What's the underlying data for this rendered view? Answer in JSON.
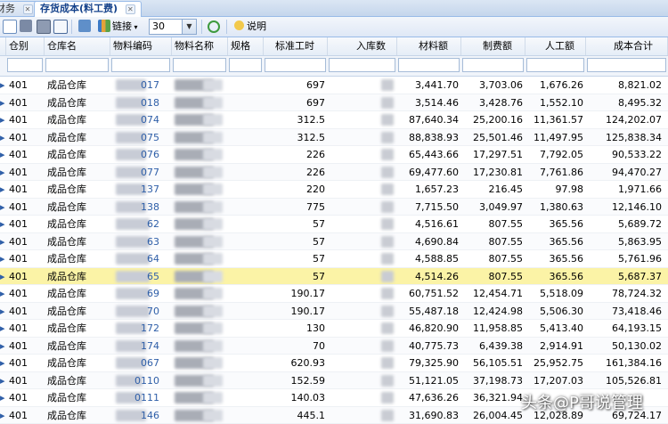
{
  "tabs": [
    {
      "label": "财务",
      "active": false
    },
    {
      "label": "存货成本(料工费)",
      "active": true
    }
  ],
  "toolbar": {
    "link_label": "链接",
    "page_size": "30",
    "help_label": "说明"
  },
  "columns": [
    "仓别",
    "仓库名",
    "物料编码",
    "物料名称",
    "规格",
    "标准工时",
    "入库数",
    "材料额",
    "制费额",
    "人工额",
    "成本合计"
  ],
  "rows": [
    {
      "wh": "401",
      "wh_name": "成品仓库",
      "code_tail": "017",
      "std_hours": "697",
      "material": "3,441.70",
      "overhead": "3,703.06",
      "labor": "1,676.26",
      "total": "8,821.02"
    },
    {
      "wh": "401",
      "wh_name": "成品仓库",
      "code_tail": "018",
      "std_hours": "697",
      "material": "3,514.46",
      "overhead": "3,428.76",
      "labor": "1,552.10",
      "total": "8,495.32"
    },
    {
      "wh": "401",
      "wh_name": "成品仓库",
      "code_tail": "074",
      "std_hours": "312.5",
      "material": "87,640.34",
      "overhead": "25,200.16",
      "labor": "11,361.57",
      "total": "124,202.07"
    },
    {
      "wh": "401",
      "wh_name": "成品仓库",
      "code_tail": "075",
      "std_hours": "312.5",
      "material": "88,838.93",
      "overhead": "25,501.46",
      "labor": "11,497.95",
      "total": "125,838.34"
    },
    {
      "wh": "401",
      "wh_name": "成品仓库",
      "code_tail": "076",
      "std_hours": "226",
      "material": "65,443.66",
      "overhead": "17,297.51",
      "labor": "7,792.05",
      "total": "90,533.22"
    },
    {
      "wh": "401",
      "wh_name": "成品仓库",
      "code_tail": "077",
      "std_hours": "226",
      "material": "69,477.60",
      "overhead": "17,230.81",
      "labor": "7,761.86",
      "total": "94,470.27"
    },
    {
      "wh": "401",
      "wh_name": "成品仓库",
      "code_tail": "137",
      "std_hours": "220",
      "material": "1,657.23",
      "overhead": "216.45",
      "labor": "97.98",
      "total": "1,971.66"
    },
    {
      "wh": "401",
      "wh_name": "成品仓库",
      "code_tail": "138",
      "std_hours": "775",
      "material": "7,715.50",
      "overhead": "3,049.97",
      "labor": "1,380.63",
      "total": "12,146.10"
    },
    {
      "wh": "401",
      "wh_name": "成品仓库",
      "code_tail": "62",
      "std_hours": "57",
      "material": "4,516.61",
      "overhead": "807.55",
      "labor": "365.56",
      "total": "5,689.72"
    },
    {
      "wh": "401",
      "wh_name": "成品仓库",
      "code_tail": "63",
      "std_hours": "57",
      "material": "4,690.84",
      "overhead": "807.55",
      "labor": "365.56",
      "total": "5,863.95"
    },
    {
      "wh": "401",
      "wh_name": "成品仓库",
      "code_tail": "64",
      "std_hours": "57",
      "material": "4,588.85",
      "overhead": "807.55",
      "labor": "365.56",
      "total": "5,761.96"
    },
    {
      "wh": "401",
      "wh_name": "成品仓库",
      "code_tail": "65",
      "std_hours": "57",
      "material": "4,514.26",
      "overhead": "807.55",
      "labor": "365.56",
      "total": "5,687.37",
      "selected": true
    },
    {
      "wh": "401",
      "wh_name": "成品仓库",
      "code_tail": "69",
      "std_hours": "190.17",
      "material": "60,751.52",
      "overhead": "12,454.71",
      "labor": "5,518.09",
      "total": "78,724.32"
    },
    {
      "wh": "401",
      "wh_name": "成品仓库",
      "code_tail": "70",
      "std_hours": "190.17",
      "material": "55,487.18",
      "overhead": "12,424.98",
      "labor": "5,506.30",
      "total": "73,418.46"
    },
    {
      "wh": "401",
      "wh_name": "成品仓库",
      "code_tail": "172",
      "std_hours": "130",
      "material": "46,820.90",
      "overhead": "11,958.85",
      "labor": "5,413.40",
      "total": "64,193.15"
    },
    {
      "wh": "401",
      "wh_name": "成品仓库",
      "code_tail": "174",
      "std_hours": "70",
      "material": "40,775.73",
      "overhead": "6,439.38",
      "labor": "2,914.91",
      "total": "50,130.02"
    },
    {
      "wh": "401",
      "wh_name": "成品仓库",
      "code_tail": "067",
      "std_hours": "620.93",
      "material": "79,325.90",
      "overhead": "56,105.51",
      "labor": "25,952.75",
      "total": "161,384.16"
    },
    {
      "wh": "401",
      "wh_name": "成品仓库",
      "code_tail": "0110",
      "std_hours": "152.59",
      "material": "51,121.05",
      "overhead": "37,198.73",
      "labor": "17,207.03",
      "total": "105,526.81"
    },
    {
      "wh": "401",
      "wh_name": "成品仓库",
      "code_tail": "0111",
      "std_hours": "140.03",
      "material": "47,636.26",
      "overhead": "36,321.94",
      "labor": "",
      "total": ""
    },
    {
      "wh": "401",
      "wh_name": "成品仓库",
      "code_tail": "146",
      "std_hours": "445.1",
      "material": "31,690.83",
      "overhead": "26,004.45",
      "labor": "12,028.89",
      "total": "69,724.17"
    }
  ],
  "watermark": "头条@P哥说管理",
  "colors": {
    "selected_row": "#fbf3a6",
    "header_bg": "#e5edf7",
    "accent": "#15428b"
  }
}
